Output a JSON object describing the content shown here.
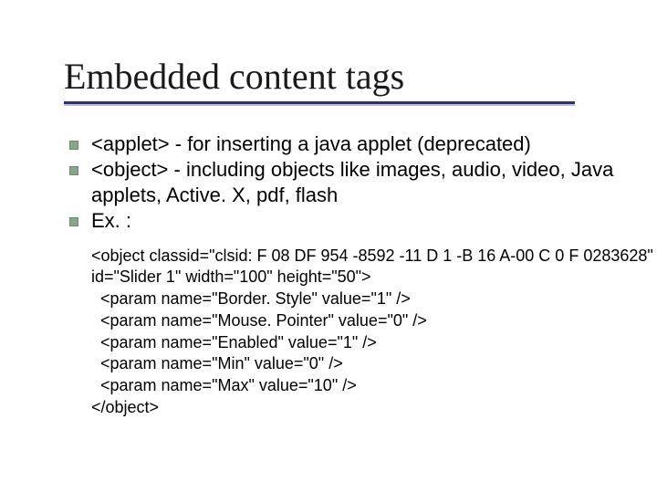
{
  "title": "Embedded content tags",
  "bullets": [
    "<applet> - for inserting a java applet (deprecated)",
    "<object> - including objects like images, audio, video, Java applets, Active. X, pdf, flash",
    "Ex. :"
  ],
  "code": "<object classid=\"clsid: F 08 DF 954 -8592 -11 D 1 -B 16 A-00 C 0 F 0283628\"\nid=\"Slider 1\" width=\"100\" height=\"50\">\n  <param name=\"Border. Style\" value=\"1\" />\n  <param name=\"Mouse. Pointer\" value=\"0\" />\n  <param name=\"Enabled\" value=\"1\" />\n  <param name=\"Min\" value=\"0\" />\n  <param name=\"Max\" value=\"10\" />\n</object>"
}
